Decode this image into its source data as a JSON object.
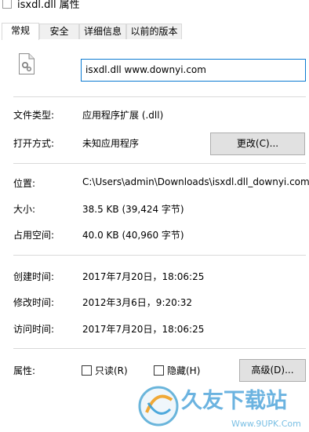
{
  "window": {
    "title": "isxdl.dll 属性"
  },
  "tabs": [
    {
      "label": "常规",
      "active": true
    },
    {
      "label": "安全",
      "active": false
    },
    {
      "label": "详细信息",
      "active": false
    },
    {
      "label": "以前的版本",
      "active": false
    }
  ],
  "file": {
    "name": "isxdl.dll www.downyi.com"
  },
  "type_section": {
    "type_label": "文件类型:",
    "type_value": "应用程序扩展 (.dll)",
    "open_label": "打开方式:",
    "open_value": "未知应用程序",
    "change_button": "更改(C)..."
  },
  "location_section": {
    "location_label": "位置:",
    "location_value": "C:\\Users\\admin\\Downloads\\isxdl.dll_downyi.com\\",
    "size_label": "大小:",
    "size_value": "38.5 KB (39,424 字节)",
    "disk_label": "占用空间:",
    "disk_value": "40.0 KB (40,960 字节)"
  },
  "time_section": {
    "created_label": "创建时间:",
    "created_value": "2017年7月20日，18:06:25",
    "modified_label": "修改时间:",
    "modified_value": "2012年3月6日，9:20:32",
    "accessed_label": "访问时间:",
    "accessed_value": "2017年7月20日，18:06:25"
  },
  "attributes": {
    "label": "属性:",
    "readonly": "只读(R)",
    "hidden": "隐藏(H)",
    "advanced_button": "高级(D)..."
  },
  "watermark": {
    "brand": "久友下载站",
    "url": "Www.9UPK.Com"
  },
  "colors": {
    "accent": "#0b7ad1",
    "separator": "#d9d9d9",
    "button_bg": "#e1e1e1"
  }
}
